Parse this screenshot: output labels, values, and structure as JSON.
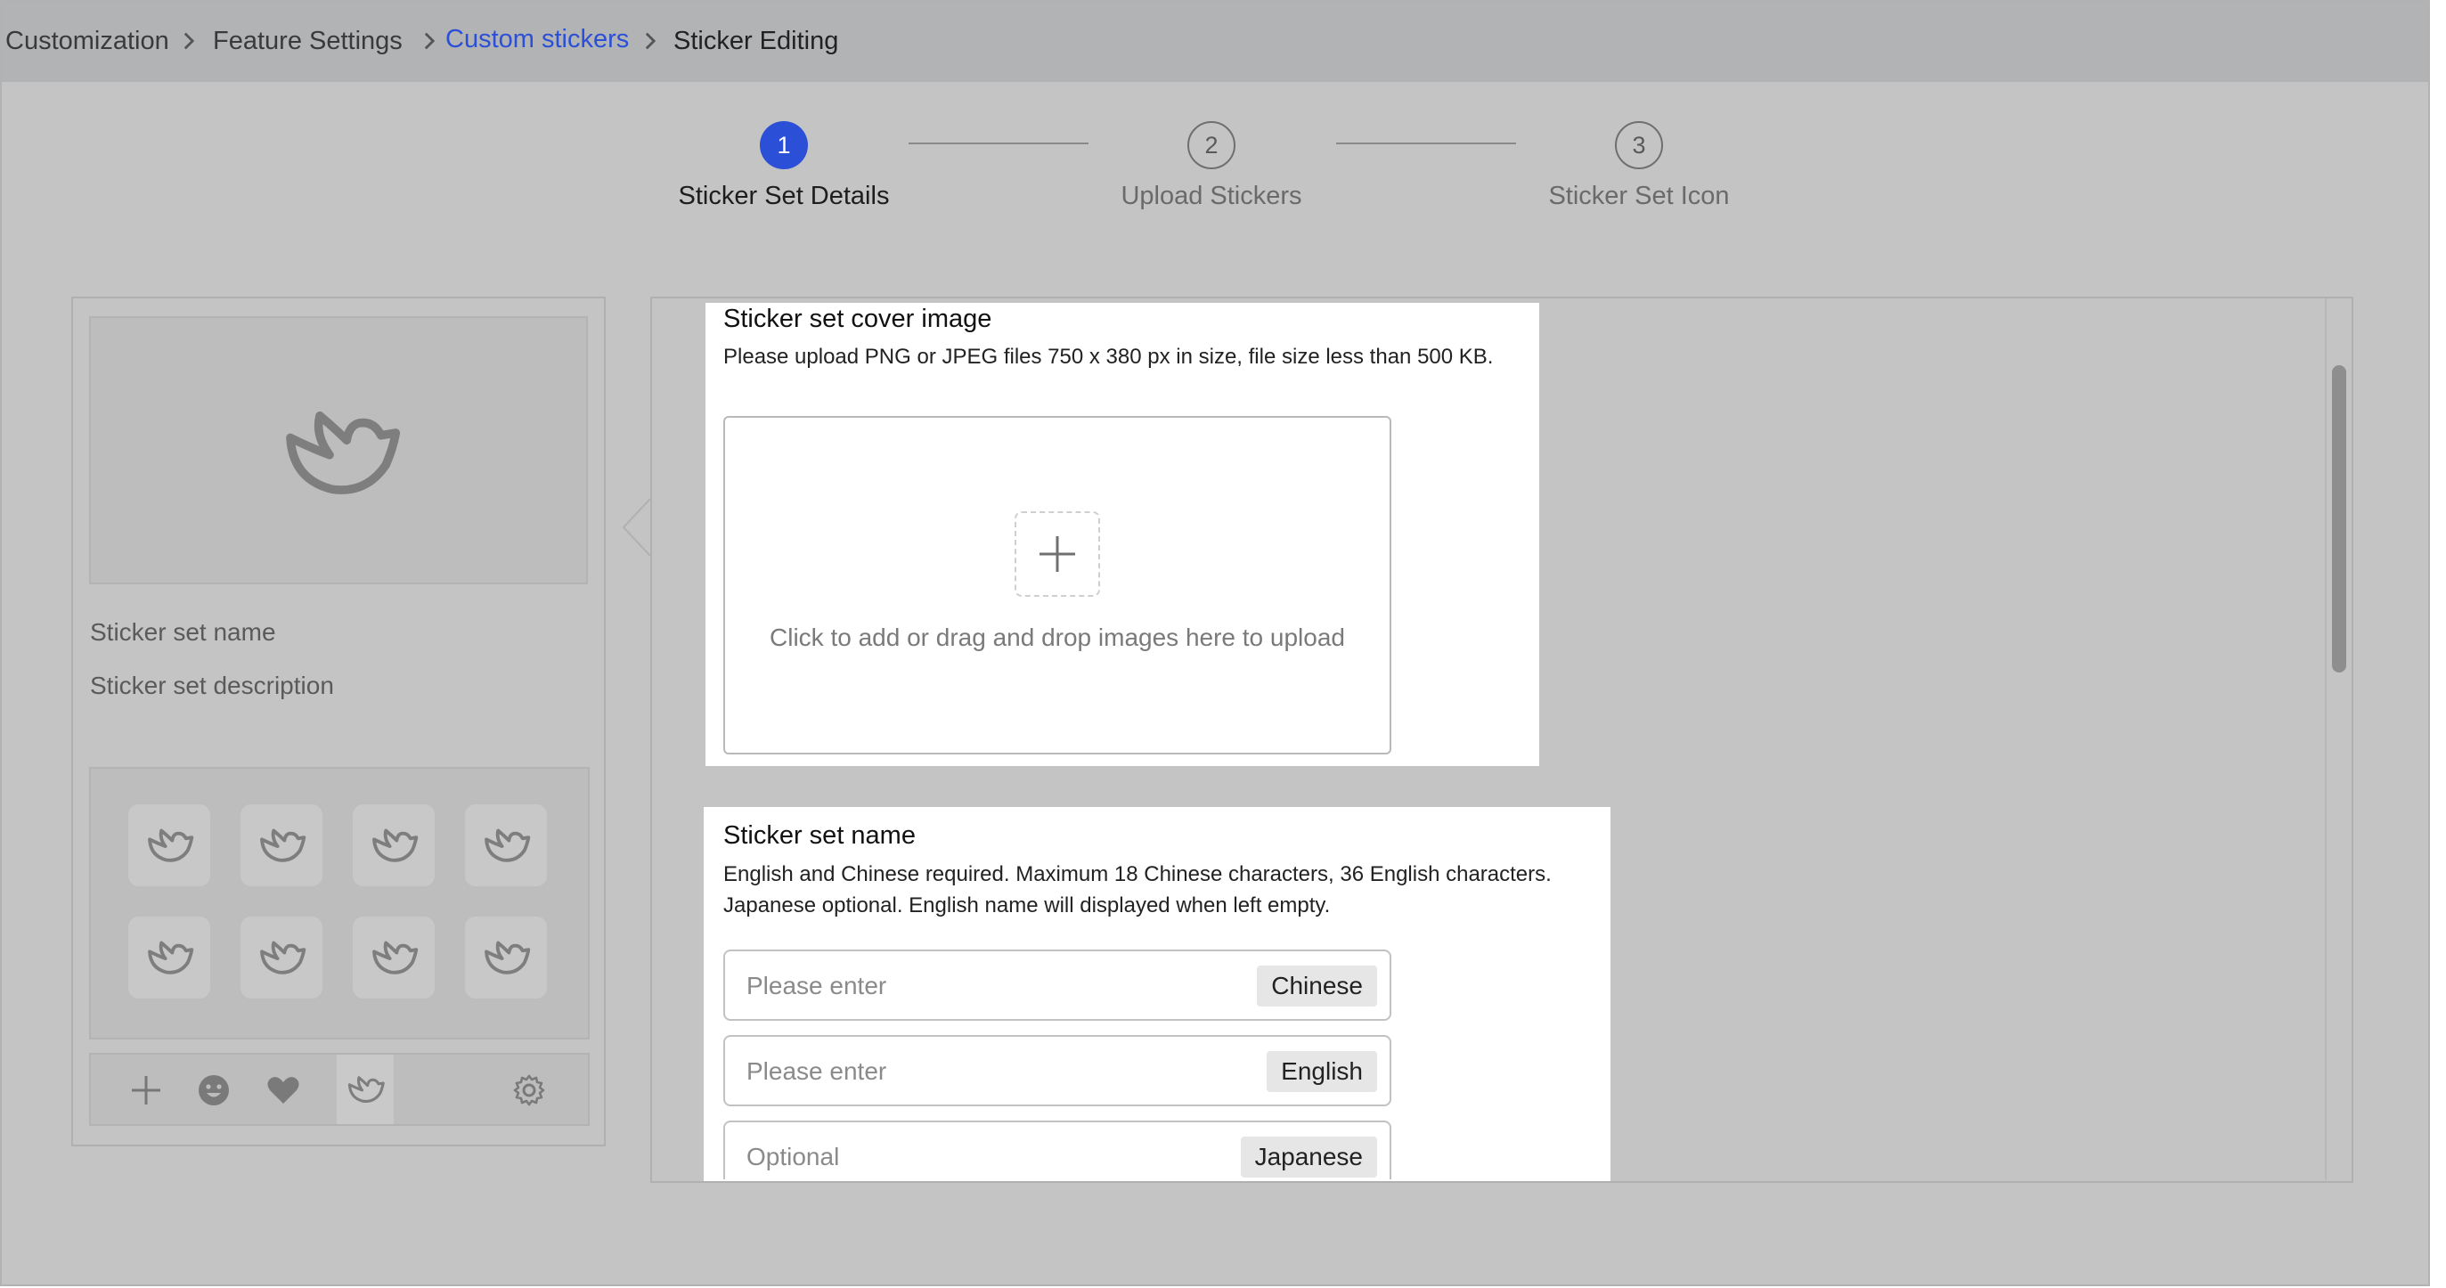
{
  "breadcrumb": {
    "items": [
      "Customization",
      "Feature Settings",
      "Custom stickers",
      "Sticker Editing"
    ]
  },
  "stepper": {
    "steps": [
      {
        "number": "1",
        "label": "Sticker Set Details",
        "state": "active"
      },
      {
        "number": "2",
        "label": "Upload Stickers",
        "state": "idle"
      },
      {
        "number": "3",
        "label": "Sticker Set Icon",
        "state": "idle"
      }
    ]
  },
  "preview": {
    "cover_icon": "sticker-bird-icon",
    "name_placeholder": "Sticker set name",
    "description_placeholder": "Sticker set description",
    "sticker_icons": [
      "sticker-bird-icon",
      "sticker-bird-icon",
      "sticker-bird-icon",
      "sticker-bird-icon",
      "sticker-bird-icon",
      "sticker-bird-icon",
      "sticker-bird-icon",
      "sticker-bird-icon"
    ],
    "toolbar_icons": [
      "plus-icon",
      "smiley-icon",
      "heart-icon",
      "sticker-bird-icon",
      "gear-icon"
    ]
  },
  "cover_section": {
    "title": "Sticker set cover image",
    "description": "Please upload PNG or JPEG files 750 x 380 px in size, file size less than 500 KB.",
    "upload_icon": "plus-icon",
    "upload_hint": "Click to add or drag and drop images here to upload"
  },
  "name_section": {
    "title": "Sticker set name",
    "description_line1": "English and Chinese required. Maximum 18 Chinese characters, 36 English characters.",
    "description_line2": "Japanese optional. English name will displayed when left empty.",
    "fields": [
      {
        "placeholder": "Please enter",
        "language": "Chinese"
      },
      {
        "placeholder": "Please enter",
        "language": "English"
      },
      {
        "placeholder": "Optional",
        "language": "Japanese"
      }
    ]
  },
  "colors": {
    "accent": "#2b4fd6",
    "overlay_gray": "#c4c4c4"
  }
}
